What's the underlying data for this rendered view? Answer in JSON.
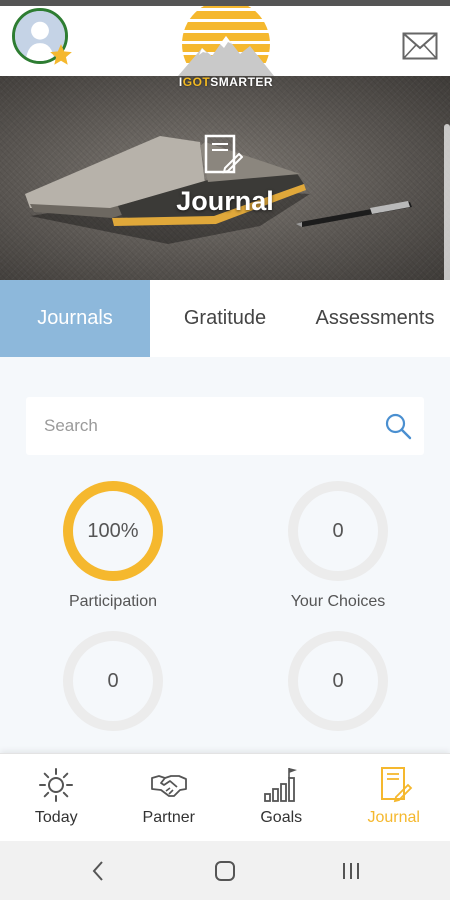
{
  "header": {
    "logo_text_pre": "I",
    "logo_text_got": "GOT",
    "logo_text_post": "SMARTER"
  },
  "hero": {
    "title": "Journal"
  },
  "tabs": [
    {
      "label": "Journals",
      "active": true
    },
    {
      "label": "Gratitude",
      "active": false
    },
    {
      "label": "Assessments",
      "active": false
    }
  ],
  "search": {
    "placeholder": "Search",
    "value": ""
  },
  "stats": [
    {
      "value": "100%",
      "label": "Participation",
      "progress": 1.0
    },
    {
      "value": "0",
      "label": "Your Choices",
      "progress": 0
    },
    {
      "value": "0",
      "label": "",
      "progress": 0
    },
    {
      "value": "0",
      "label": "",
      "progress": 0
    }
  ],
  "bottom_nav": [
    {
      "label": "Today",
      "icon": "sun-icon",
      "active": false
    },
    {
      "label": "Partner",
      "icon": "handshake-icon",
      "active": false
    },
    {
      "label": "Goals",
      "icon": "goals-chart-icon",
      "active": false
    },
    {
      "label": "Journal",
      "icon": "journal-icon",
      "active": true
    }
  ],
  "colors": {
    "accent_gold": "#f5b82e",
    "tab_active": "#8db8db",
    "avatar_ring": "#2e7d32",
    "search_icon": "#4a8fd0"
  }
}
